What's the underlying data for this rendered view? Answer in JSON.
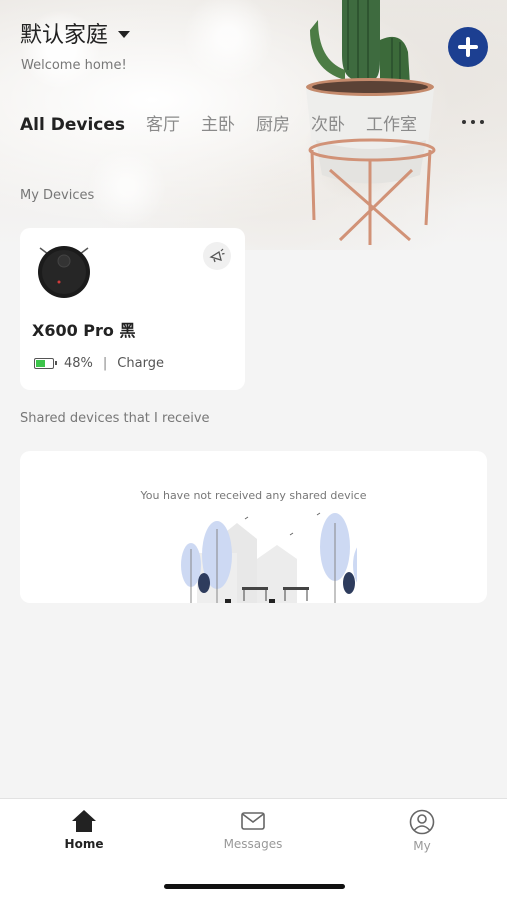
{
  "header": {
    "home_name": "默认家庭",
    "welcome": "Welcome home!"
  },
  "tabs": [
    {
      "label": "All Devices"
    },
    {
      "label": "客厅"
    },
    {
      "label": "主卧"
    },
    {
      "label": "厨房"
    },
    {
      "label": "次卧"
    },
    {
      "label": "工作室"
    }
  ],
  "sections": {
    "my_devices": "My Devices",
    "shared": "Shared devices that I receive"
  },
  "device": {
    "name": "X600 Pro 黑",
    "battery": "48%",
    "battery_level": 0.48,
    "separator": "|",
    "status": "Charge"
  },
  "shared": {
    "empty_text": "You have not received any shared device"
  },
  "tabbar": {
    "home": "Home",
    "messages": "Messages",
    "my": "My"
  },
  "colors": {
    "accent": "#1c3f91",
    "battery": "#3cc44a",
    "background": "#f4f4f4"
  }
}
